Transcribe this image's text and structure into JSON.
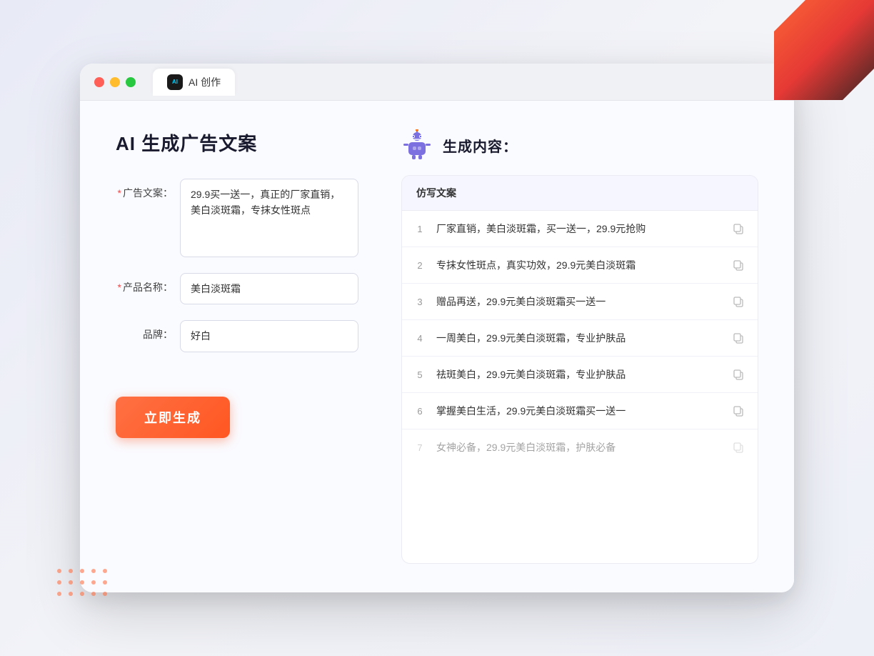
{
  "window": {
    "tab_label": "AI 创作"
  },
  "page": {
    "title": "AI 生成广告文案",
    "right_title": "生成内容："
  },
  "form": {
    "ad_copy_label": "广告文案：",
    "ad_copy_required": "*",
    "ad_copy_value": "29.9买一送一，真正的厂家直销，美白淡斑霜，专抹女性斑点",
    "product_name_label": "产品名称：",
    "product_name_required": "*",
    "product_name_value": "美白淡斑霜",
    "brand_label": "品牌：",
    "brand_value": "好白",
    "generate_btn": "立即生成"
  },
  "results": {
    "column_header": "仿写文案",
    "items": [
      {
        "num": "1",
        "text": "厂家直销，美白淡斑霜，买一送一，29.9元抢购",
        "muted": false
      },
      {
        "num": "2",
        "text": "专抹女性斑点，真实功效，29.9元美白淡斑霜",
        "muted": false
      },
      {
        "num": "3",
        "text": "赠品再送，29.9元美白淡斑霜买一送一",
        "muted": false
      },
      {
        "num": "4",
        "text": "一周美白，29.9元美白淡斑霜，专业护肤品",
        "muted": false
      },
      {
        "num": "5",
        "text": "祛斑美白，29.9元美白淡斑霜，专业护肤品",
        "muted": false
      },
      {
        "num": "6",
        "text": "掌握美白生活，29.9元美白淡斑霜买一送一",
        "muted": false
      },
      {
        "num": "7",
        "text": "女神必备，29.9元美白淡斑霜，护肤必备",
        "muted": true
      }
    ]
  }
}
